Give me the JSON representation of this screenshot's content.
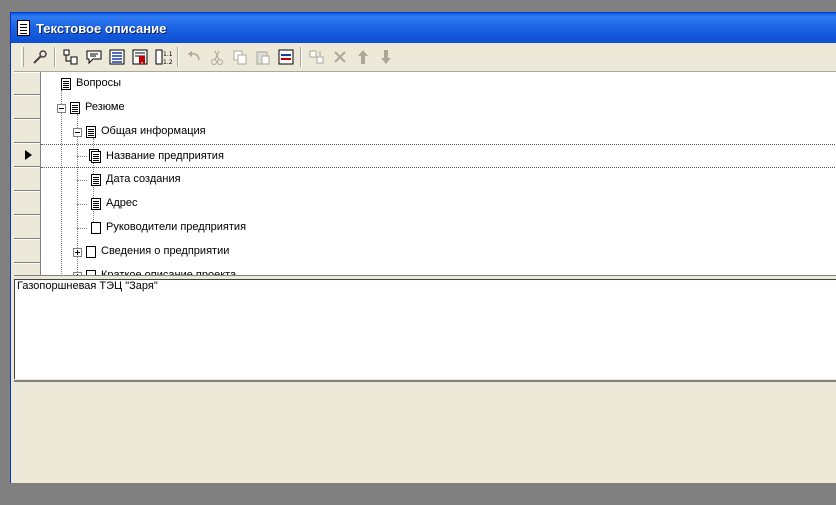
{
  "window": {
    "title": "Текстовое описание"
  },
  "toolbar": {
    "groups": [
      [
        "wrench-icon"
      ],
      [
        "tree-add-icon",
        "comment-icon",
        "list-view-icon",
        "bookmark-red-icon",
        "numbering-icon"
      ],
      [
        "undo-icon",
        "cut-icon",
        "copy-icon",
        "paste-icon",
        "properties-icon"
      ],
      [
        "move-node-icon",
        "delete-icon",
        "move-up-icon",
        "move-down-icon"
      ]
    ]
  },
  "tree": {
    "items": [
      {
        "label": "Вопросы",
        "level": 0,
        "expander": "none",
        "icon": "doc-lines"
      },
      {
        "label": "Резюме",
        "level": 0,
        "expander": "minus",
        "icon": "doc-lines"
      },
      {
        "label": "Общая информация",
        "level": 1,
        "expander": "minus",
        "icon": "doc-lines"
      },
      {
        "label": "Название предприятия",
        "level": 2,
        "expander": "none",
        "icon": "doc-lines-stack",
        "selected": true
      },
      {
        "label": "Дата создания",
        "level": 2,
        "expander": "none",
        "icon": "doc-lines"
      },
      {
        "label": "Адрес",
        "level": 2,
        "expander": "none",
        "icon": "doc-lines"
      },
      {
        "label": "Руководители предприятия",
        "level": 2,
        "expander": "none",
        "icon": "doc-empty"
      },
      {
        "label": "Сведения о предприятии",
        "level": 1,
        "expander": "plus",
        "icon": "doc-empty"
      },
      {
        "label": "Краткое описание проекта",
        "level": 1,
        "expander": "plus",
        "icon": "doc-empty"
      }
    ]
  },
  "editor": {
    "text": "Газопоршневая ТЭЦ \"Заря\""
  }
}
